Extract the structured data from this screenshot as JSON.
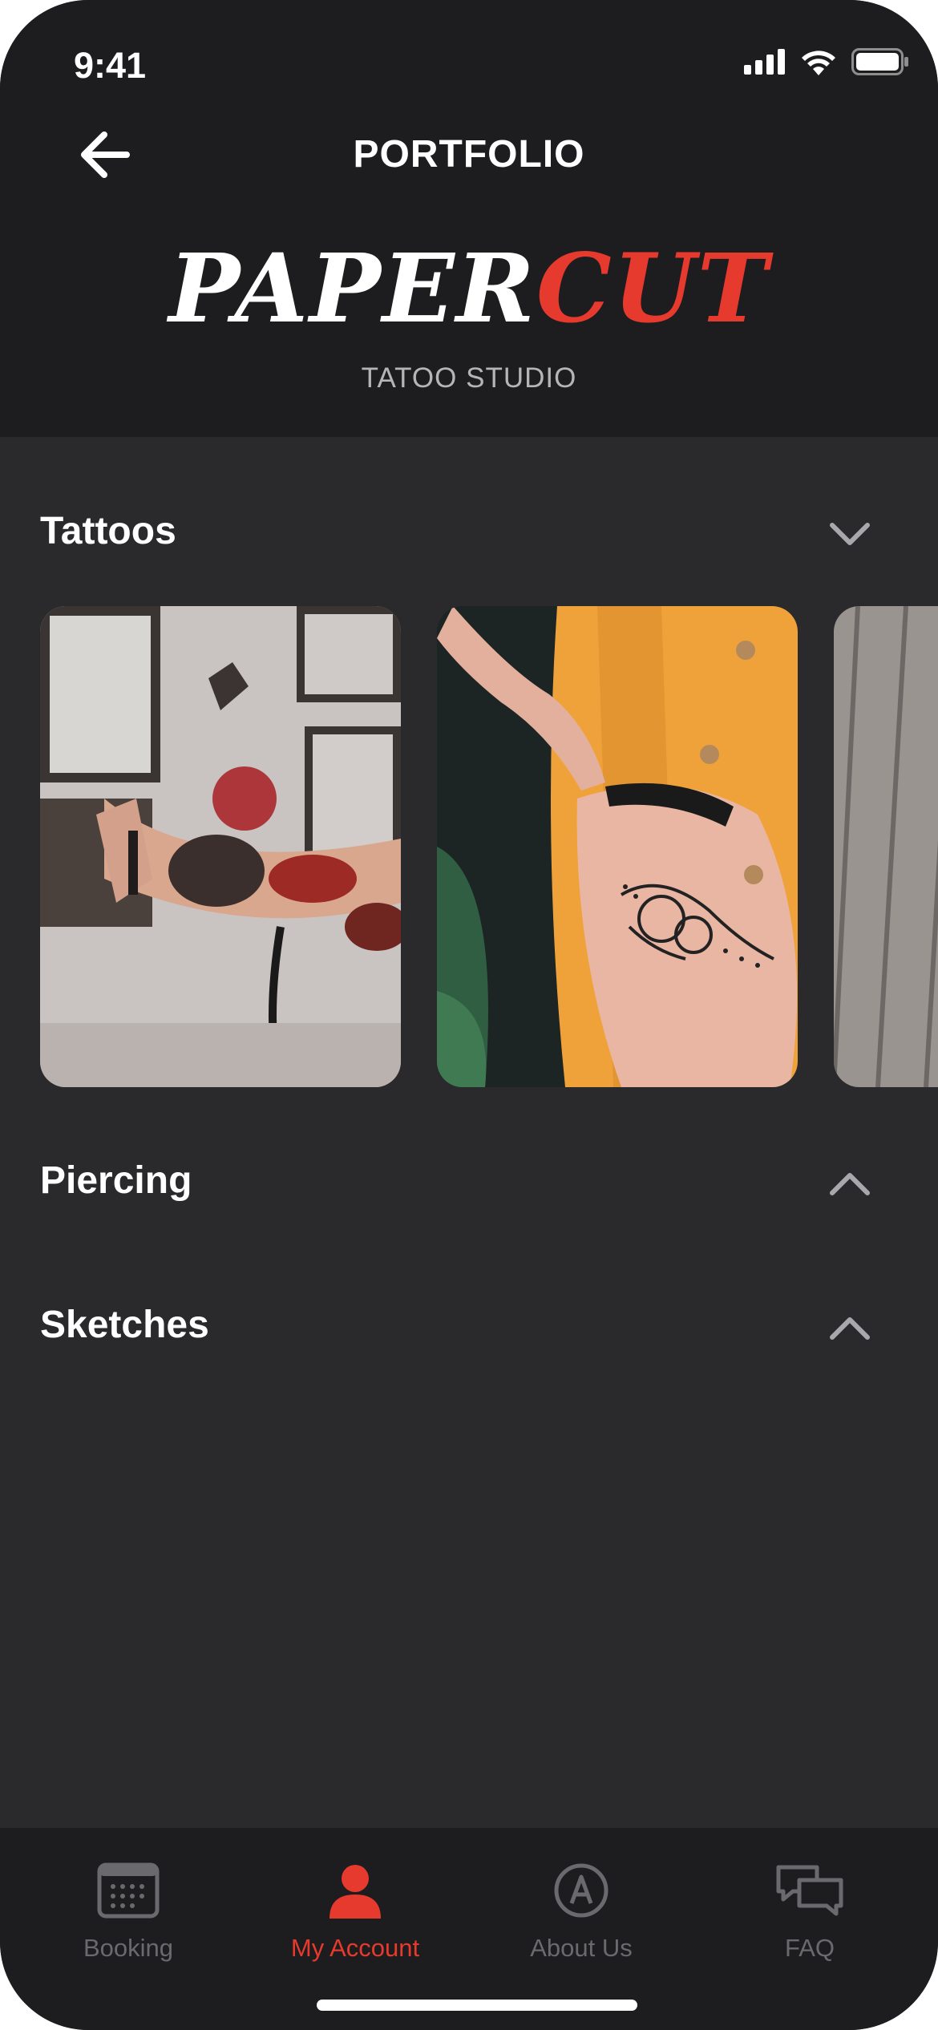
{
  "status": {
    "time": "9:41"
  },
  "header": {
    "title": "PORTFOLIO",
    "logo_part1": "PAPER",
    "logo_part2": "CUT",
    "subtitle": "TATOO STUDIO"
  },
  "sections": [
    {
      "title": "Tattoos",
      "expanded": true,
      "chevron": "chevron-down-icon"
    },
    {
      "title": "Piercing",
      "expanded": false,
      "chevron": "chevron-up-icon"
    },
    {
      "title": "Sketches",
      "expanded": false,
      "chevron": "chevron-up-icon"
    }
  ],
  "tabbar": {
    "items": [
      {
        "label": "Booking",
        "icon": "calendar-icon",
        "active": false
      },
      {
        "label": "My Account",
        "icon": "user-icon",
        "active": true
      },
      {
        "label": "About Us",
        "icon": "about-icon",
        "active": false
      },
      {
        "label": "FAQ",
        "icon": "chat-icon",
        "active": false
      }
    ]
  },
  "colors": {
    "accent": "#e63a2e",
    "header_bg": "#1d1d1f",
    "content_bg": "#2a2a2d",
    "inactive": "#6a6a6e"
  }
}
